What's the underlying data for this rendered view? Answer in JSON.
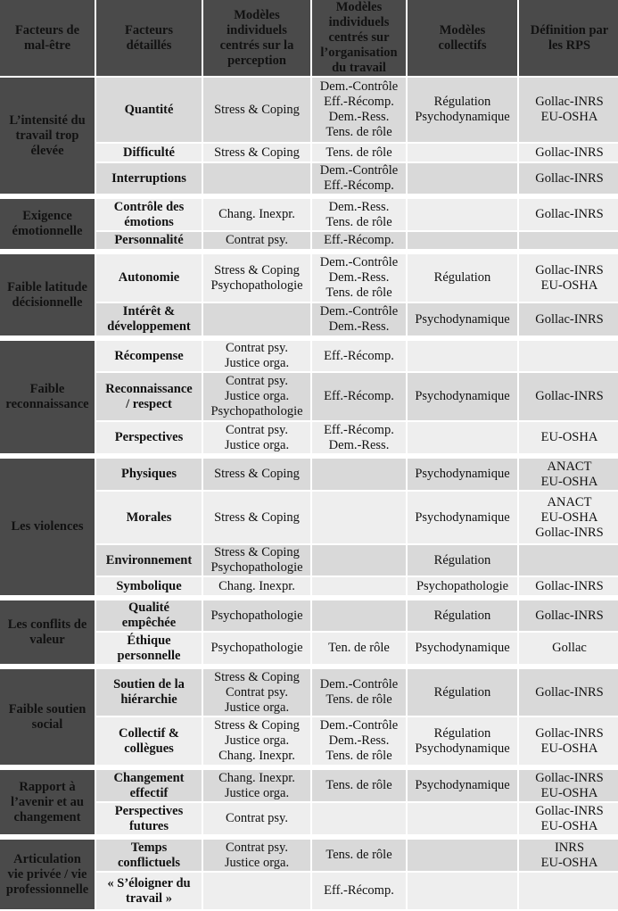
{
  "headers": [
    "Facteurs de\nmal-être",
    "Facteurs\ndétaillés",
    "Modèles\nindividuels\ncentrés sur la\nperception",
    "Modèles\nindividuels\ncentrés sur\nl’organisation\ndu travail",
    "Modèles\ncollectifs",
    "Définition par\nles RPS"
  ],
  "colors": {
    "header_bg": "#4a4a4a",
    "row_dark": "#d9d9d9",
    "row_light": "#eeeeee"
  },
  "groups": [
    {
      "label": "L’intensité du\ntravail trop\nélevée",
      "rows": [
        {
          "factor": "Quantité",
          "perception": "Stress & Coping",
          "organisation": "Dem.-Contrôle\nEff.-Récomp.\nDem.-Ress.\nTens. de rôle",
          "collectifs": "Régulation\nPsychodynamique",
          "rps": "Gollac-INRS\nEU-OSHA"
        },
        {
          "factor": "Difficulté",
          "perception": "Stress & Coping",
          "organisation": "Tens. de rôle",
          "collectifs": "",
          "rps": "Gollac-INRS"
        },
        {
          "factor": "Interruptions",
          "perception": "",
          "organisation": "Dem.-Contrôle\nEff.-Récomp.",
          "collectifs": "",
          "rps": "Gollac-INRS"
        }
      ]
    },
    {
      "label": "Exigence\némotionnelle",
      "rows": [
        {
          "factor": "Contrôle des\némotions",
          "perception": "Chang. Inexpr.",
          "organisation": "Dem.-Ress.\nTens. de rôle",
          "collectifs": "",
          "rps": "Gollac-INRS"
        },
        {
          "factor": "Personnalité",
          "perception": "Contrat psy.",
          "organisation": "Eff.-Récomp.",
          "collectifs": "",
          "rps": ""
        }
      ]
    },
    {
      "label": "Faible latitude\ndécisionnelle",
      "rows": [
        {
          "factor": "Autonomie",
          "perception": "Stress & Coping\nPsychopathologie",
          "organisation": "Dem.-Contrôle\nDem.-Ress.\nTens. de rôle",
          "collectifs": "Régulation",
          "rps": "Gollac-INRS\nEU-OSHA"
        },
        {
          "factor": "Intérêt &\ndéveloppement",
          "perception": "",
          "organisation": "Dem.-Contrôle\nDem.-Ress.",
          "collectifs": "Psychodynamique",
          "rps": "Gollac-INRS"
        }
      ]
    },
    {
      "label": "Faible\nreconnaissance",
      "rows": [
        {
          "factor": "Récompense",
          "perception": "Contrat psy.\nJustice orga.",
          "organisation": "Eff.-Récomp.",
          "collectifs": "",
          "rps": ""
        },
        {
          "factor": "Reconnaissance\n/ respect",
          "perception": "Contrat psy.\nJustice orga.\nPsychopathologie",
          "organisation": "Eff.-Récomp.",
          "collectifs": "Psychodynamique",
          "rps": "Gollac-INRS"
        },
        {
          "factor": "Perspectives",
          "perception": "Contrat psy.\nJustice orga.",
          "organisation": "Eff.-Récomp.\nDem.-Ress.",
          "collectifs": "",
          "rps": "EU-OSHA"
        }
      ]
    },
    {
      "label": "Les violences",
      "rows": [
        {
          "factor": "Physiques",
          "perception": "Stress & Coping",
          "organisation": "",
          "collectifs": "Psychodynamique",
          "rps": "ANACT\nEU-OSHA"
        },
        {
          "factor": "Morales",
          "perception": "Stress & Coping",
          "organisation": "",
          "collectifs": "Psychodynamique",
          "rps": "ANACT\nEU-OSHA\nGollac-INRS"
        },
        {
          "factor": "Environnement",
          "perception": "Stress & Coping\nPsychopathologie",
          "organisation": "",
          "collectifs": "Régulation",
          "rps": ""
        },
        {
          "factor": "Symbolique",
          "perception": "Chang. Inexpr.",
          "organisation": "",
          "collectifs": "Psychopathologie",
          "rps": "Gollac-INRS"
        }
      ]
    },
    {
      "label": "Les conflits de\nvaleur",
      "rows": [
        {
          "factor": "Qualité\nempêchée",
          "perception": "Psychopathologie",
          "organisation": "",
          "collectifs": "Régulation",
          "rps": "Gollac-INRS"
        },
        {
          "factor": "Éthique\npersonnelle",
          "perception": "Psychopathologie",
          "organisation": "Ten. de rôle",
          "collectifs": "Psychodynamique",
          "rps": "Gollac"
        }
      ]
    },
    {
      "label": "Faible soutien\nsocial",
      "rows": [
        {
          "factor": "Soutien de la\nhiérarchie",
          "perception": "Stress & Coping\nContrat psy.\nJustice orga.",
          "organisation": "Dem.-Contrôle\nTens. de rôle",
          "collectifs": "Régulation",
          "rps": "Gollac-INRS"
        },
        {
          "factor": "Collectif &\ncollègues",
          "perception": "Stress & Coping\nJustice orga.\nChang. Inexpr.",
          "organisation": "Dem.-Contrôle\nDem.-Ress.\nTens. de rôle",
          "collectifs": "Régulation\nPsychodynamique",
          "rps": "Gollac-INRS\nEU-OSHA"
        }
      ]
    },
    {
      "label": "Rapport à\nl’avenir et au\nchangement",
      "rows": [
        {
          "factor": "Changement\neffectif",
          "perception": "Chang. Inexpr.\nJustice orga.",
          "organisation": "Tens. de rôle",
          "collectifs": "Psychodynamique",
          "rps": "Gollac-INRS\nEU-OSHA"
        },
        {
          "factor": "Perspectives\nfutures",
          "perception": "Contrat psy.",
          "organisation": "",
          "collectifs": "",
          "rps": "Gollac-INRS\nEU-OSHA"
        }
      ]
    },
    {
      "label": "Articulation\nvie privée / vie\nprofessionnelle",
      "rows": [
        {
          "factor": "Temps\nconflictuels",
          "perception": "Contrat psy.\nJustice orga.",
          "organisation": "Tens. de rôle",
          "collectifs": "",
          "rps": "INRS\nEU-OSHA"
        },
        {
          "factor": "« S’éloigner du\ntravail »",
          "perception": "",
          "organisation": "Eff.-Récomp.",
          "collectifs": "",
          "rps": ""
        }
      ]
    }
  ]
}
